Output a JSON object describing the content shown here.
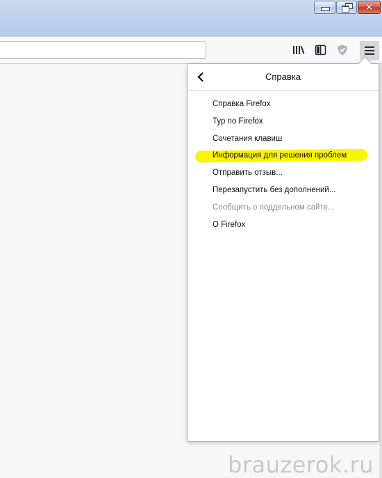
{
  "window": {
    "controls": {
      "minimize_icon": "minimize-icon",
      "restore_icon": "restore-icon",
      "close_icon": "close-icon",
      "close_glyph": "✕"
    }
  },
  "toolbar": {
    "url_value": "",
    "icons": [
      "library-icon",
      "sidebar-icon",
      "tracking-protection-icon",
      "hamburger-menu-icon"
    ]
  },
  "help_panel": {
    "title": "Справка",
    "back_icon": "chevron-left-icon",
    "items": [
      {
        "label": "Справка Firefox",
        "disabled": false,
        "highlighted": false
      },
      {
        "label": "Тур по Firefox",
        "disabled": false,
        "highlighted": false
      },
      {
        "label": "Сочетания клавиш",
        "disabled": false,
        "highlighted": false
      },
      {
        "label": "Информация для решения проблем",
        "disabled": false,
        "highlighted": true
      },
      {
        "label": "Отправить отзыв...",
        "disabled": false,
        "highlighted": false
      },
      {
        "label": "Перезапустить без дополнений...",
        "disabled": false,
        "highlighted": false
      },
      {
        "label": "Сообщить о поддельном сайте...",
        "disabled": true,
        "highlighted": false
      },
      {
        "label": "О Firefox",
        "disabled": false,
        "highlighted": false
      }
    ]
  },
  "colors": {
    "highlight": "#fbf402",
    "disabled_text": "#8a8a8f",
    "text": "#0c0c0d"
  },
  "watermark": "brauzerok.ru"
}
